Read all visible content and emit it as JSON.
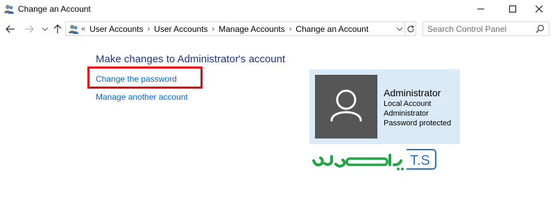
{
  "window": {
    "title": "Change an Account"
  },
  "address": {
    "lead": "«",
    "crumbs": [
      "User Accounts",
      "User Accounts",
      "Manage Accounts",
      "Change an Account"
    ]
  },
  "search": {
    "placeholder": "Search Control Panel"
  },
  "main": {
    "heading": "Make changes to Administrator's account",
    "links": {
      "change_password": "Change the password",
      "manage_another": "Manage another account"
    }
  },
  "account": {
    "name": "Administrator",
    "type": "Local Account",
    "group": "Administrator",
    "status": "Password protected"
  },
  "logo": {
    "latin": "T.S",
    "persian": "تهران‌روز"
  },
  "colors": {
    "heading": "#1e3287",
    "link": "#0066cc",
    "highlight": "#e8000b",
    "card_bg": "#dbeaf7",
    "avatar_bg": "#565656",
    "logo_green": "#22a447",
    "logo_blue": "#2a73c7"
  }
}
